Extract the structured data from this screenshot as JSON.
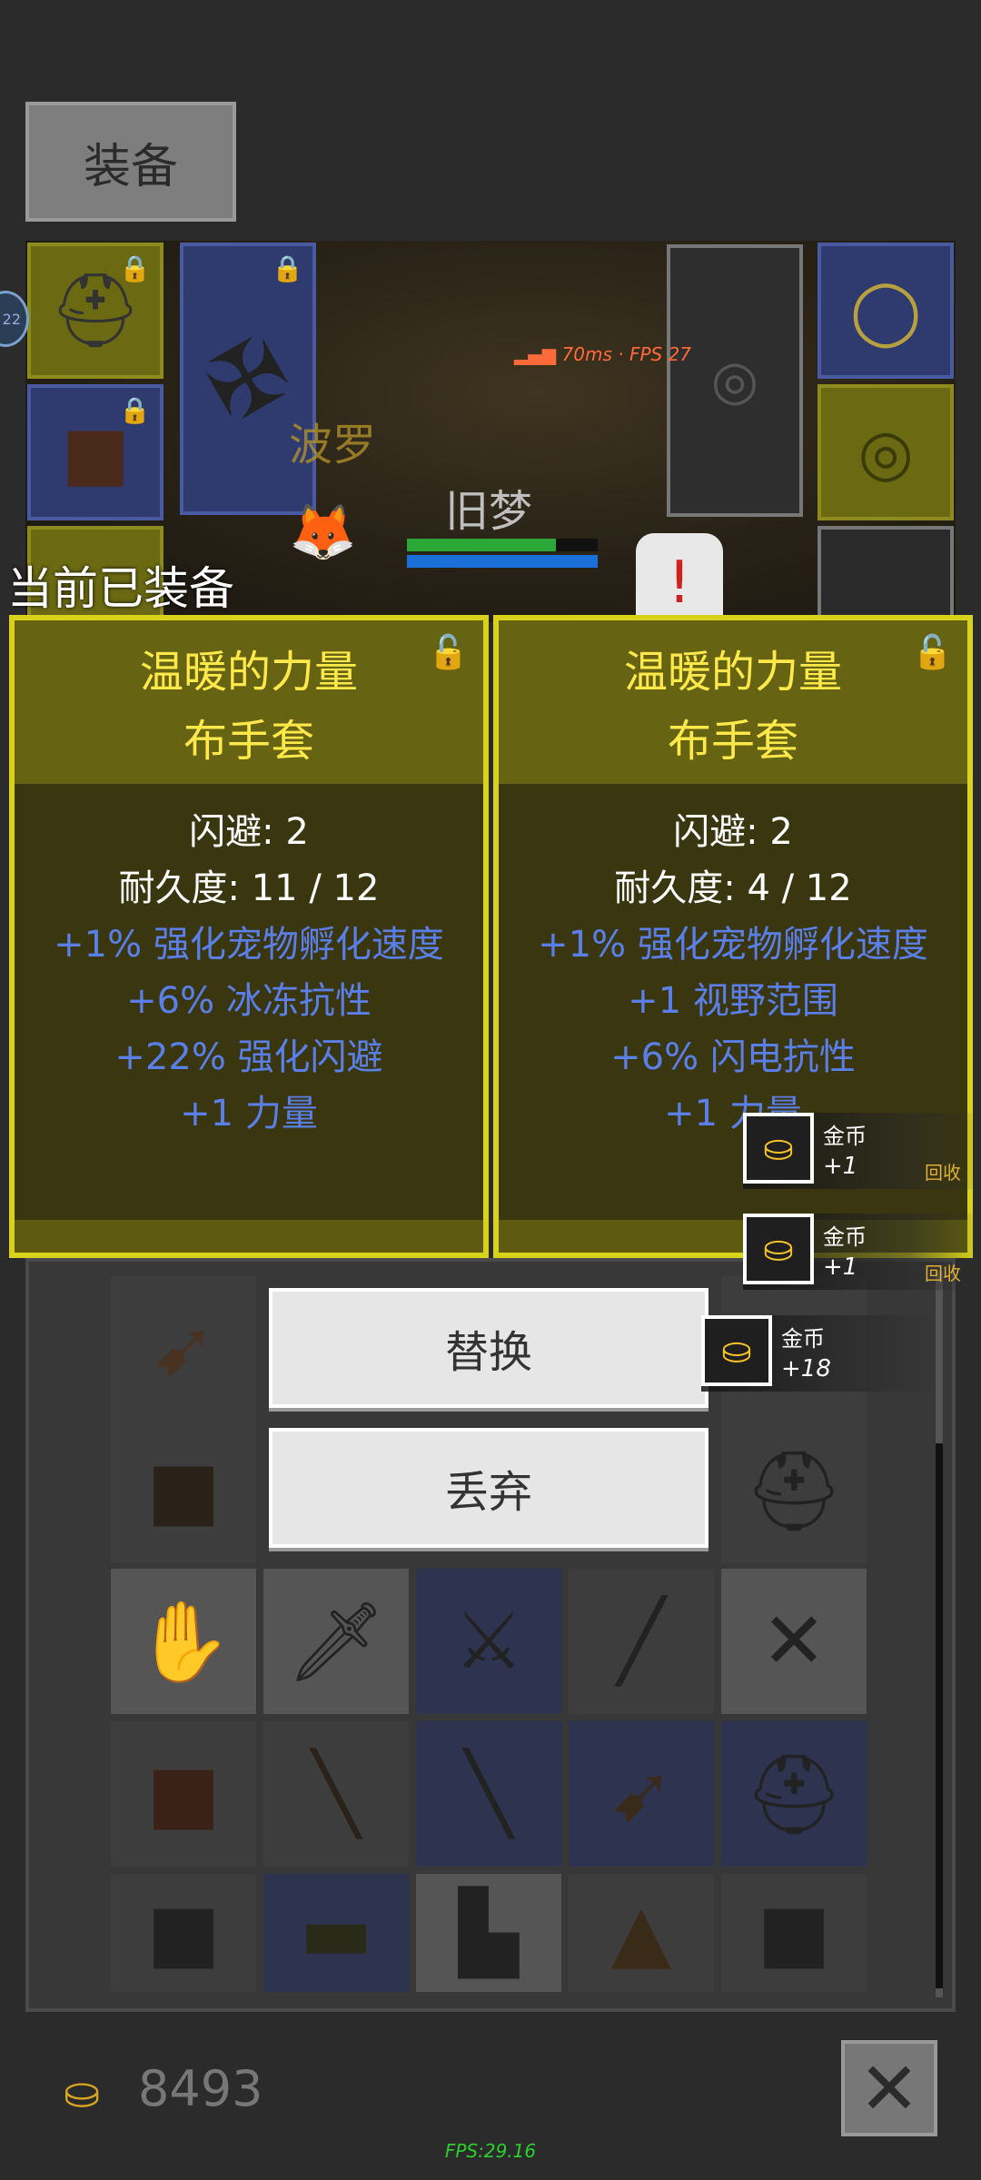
{
  "header": {
    "equip_tab_label": "装备"
  },
  "scene": {
    "player_name": "旧梦",
    "npc_name": "波罗",
    "network_status": "70ms · FPS 27",
    "level_badge": "22",
    "health_fraction": 0.78,
    "mana_fraction": 1.0
  },
  "current_equipped_label": "当前已装备",
  "compare": [
    {
      "title_line1": "温暖的力量",
      "title_line2": "布手套",
      "stats": [
        "闪避: 2",
        "耐久度: 11 / 12"
      ],
      "bonuses": [
        "+1% 强化宠物孵化速度",
        "+6% 冰冻抗性",
        "+22% 强化闪避",
        "+1 力量"
      ]
    },
    {
      "title_line1": "温暖的力量",
      "title_line2": "布手套",
      "stats": [
        "闪避: 2",
        "耐久度: 4 / 12"
      ],
      "bonuses": [
        "+1% 强化宠物孵化速度",
        "+1 视野范围",
        "+6% 闪电抗性",
        "+1 力量"
      ]
    }
  ],
  "actions": {
    "replace_label": "替换",
    "discard_label": "丢弃"
  },
  "toasts": [
    {
      "name": "金币",
      "amount": "+1",
      "recycle": "回收"
    },
    {
      "name": "金币",
      "amount": "+1",
      "recycle": "回收"
    },
    {
      "name": "金币",
      "amount": "+18",
      "recycle": ""
    }
  ],
  "footer": {
    "gold_count": "8493",
    "fps": "FPS:29.16"
  },
  "icons": {
    "lock": "lock-icon",
    "coin": "gold-coins-icon",
    "close": "close-icon"
  }
}
